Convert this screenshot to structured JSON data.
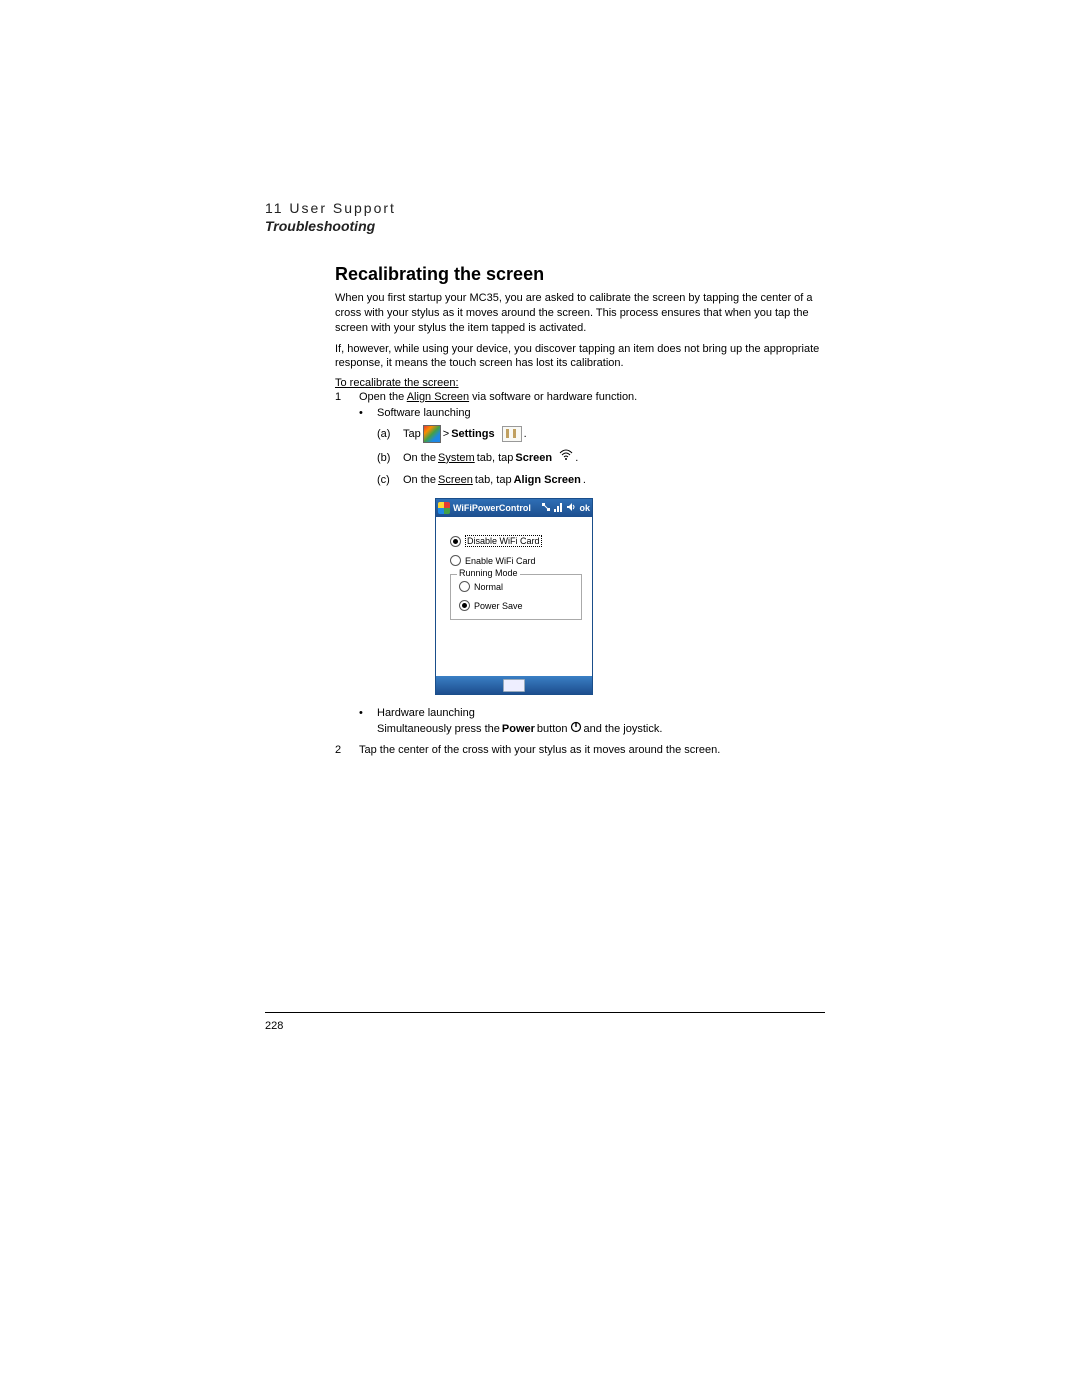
{
  "header": {
    "chapter": "11 User Support",
    "section": "Troubleshooting"
  },
  "heading": "Recalibrating the screen",
  "para1": "When you first startup your MC35, you are asked to calibrate the screen by tapping the center of a cross with your stylus as it moves around the screen. This process ensures that when you tap the screen with your stylus the item tapped is activated.",
  "para2": "If, however, while using your device, you discover tapping an item does not bring up the appropriate response, it means the touch screen has lost its calibration.",
  "procedure_title": "To recalibrate the screen:",
  "step1": {
    "num": "1",
    "text_pre": "Open the ",
    "text_link": "Align Screen",
    "text_post": " via software or hardware function.",
    "bullet_sw": "Software launching",
    "sub_a": {
      "label": "(a)",
      "pre": "Tap ",
      "mid": " > ",
      "settings": "Settings",
      "post": "."
    },
    "sub_b": {
      "label": "(b)",
      "pre": "On the ",
      "link": "System",
      "mid": " tab, tap ",
      "bold": "Screen",
      "post": " ."
    },
    "sub_c": {
      "label": "(c)",
      "pre": "On the ",
      "link": "Screen",
      "mid": " tab, tap ",
      "bold": "Align Screen",
      "post": "."
    },
    "bullet_hw": "Hardware launching",
    "hw_line": {
      "pre": "Simultaneously press the ",
      "bold": "Power",
      "mid": " button ",
      "post": " and the joystick."
    }
  },
  "step2": {
    "num": "2",
    "text": "Tap the center of the cross with your stylus as it moves around the screen."
  },
  "device": {
    "title": "WiFiPowerControl",
    "ok": "ok",
    "opt_disable": "Disable WiFi Card",
    "opt_enable": "Enable WiFi Card",
    "fieldset_legend": "Running Mode",
    "opt_normal": "Normal",
    "opt_powersave": "Power Save"
  },
  "page_number": "228"
}
